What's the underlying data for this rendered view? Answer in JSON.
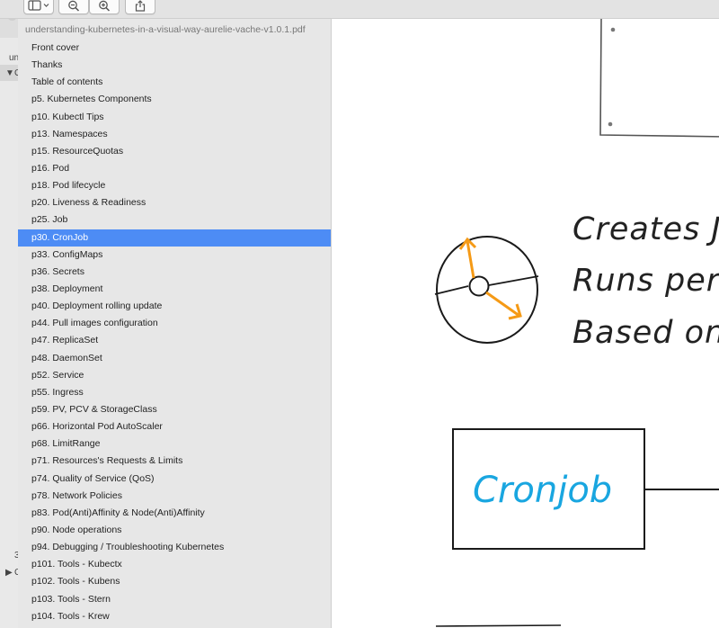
{
  "pdf_filename": "understanding-kubernetes-in-a-visual-way-aurelie-vache-v1.0.1.pdf",
  "toc": [
    {
      "label": "Front cover"
    },
    {
      "label": "Thanks"
    },
    {
      "label": "Table of contents"
    },
    {
      "label": "p5. Kubernetes Components"
    },
    {
      "label": "p10. Kubectl Tips"
    },
    {
      "label": "p13. Namespaces"
    },
    {
      "label": "p15. ResourceQuotas"
    },
    {
      "label": "p16. Pod"
    },
    {
      "label": "p18. Pod lifecycle"
    },
    {
      "label": "p20. Liveness & Readiness"
    },
    {
      "label": "p25. Job"
    },
    {
      "label": "p30. CronJob",
      "selected": true
    },
    {
      "label": "p33. ConfigMaps"
    },
    {
      "label": "p36. Secrets"
    },
    {
      "label": "p38. Deployment"
    },
    {
      "label": "p40. Deployment rolling update"
    },
    {
      "label": "p44. Pull images configuration"
    },
    {
      "label": "p47. ReplicaSet"
    },
    {
      "label": "p48. DaemonSet"
    },
    {
      "label": "p52. Service"
    },
    {
      "label": "p55. Ingress"
    },
    {
      "label": "p59. PV, PCV & StorageClass"
    },
    {
      "label": "p66. Horizontal Pod AutoScaler"
    },
    {
      "label": "p68. LimitRange"
    },
    {
      "label": "p71. Resources's Requests & Limits"
    },
    {
      "label": "p74. Quality of Service (QoS)"
    },
    {
      "label": "p78. Network Policies"
    },
    {
      "label": "p83. Pod(Anti)Affinity & Node(Anti)Affinity"
    },
    {
      "label": "p90. Node operations"
    },
    {
      "label": "p94. Debugging / Troubleshooting Kubernetes"
    },
    {
      "label": "p101. Tools - Kubectx"
    },
    {
      "label": "p102. Tools - Kubens"
    },
    {
      "label": "p103. Tools - Stern"
    },
    {
      "label": "p104. Tools - Krew"
    }
  ],
  "page": {
    "line1": "Creates Jo",
    "line2": "Runs perio",
    "line3": "Based on",
    "box_label": "Cronjob"
  },
  "bg_window": {
    "frag_un": "un",
    "frag_g": "G",
    "frag_3": "3",
    "frag_c": "C"
  },
  "colors": {
    "selection": "#4d8cf5",
    "clock_hands": "#f59a16",
    "cronjob_text": "#19a6e0"
  },
  "icons": [
    "sidebar-toggle-icon",
    "zoom-out-icon",
    "zoom-in-icon",
    "share-icon"
  ]
}
